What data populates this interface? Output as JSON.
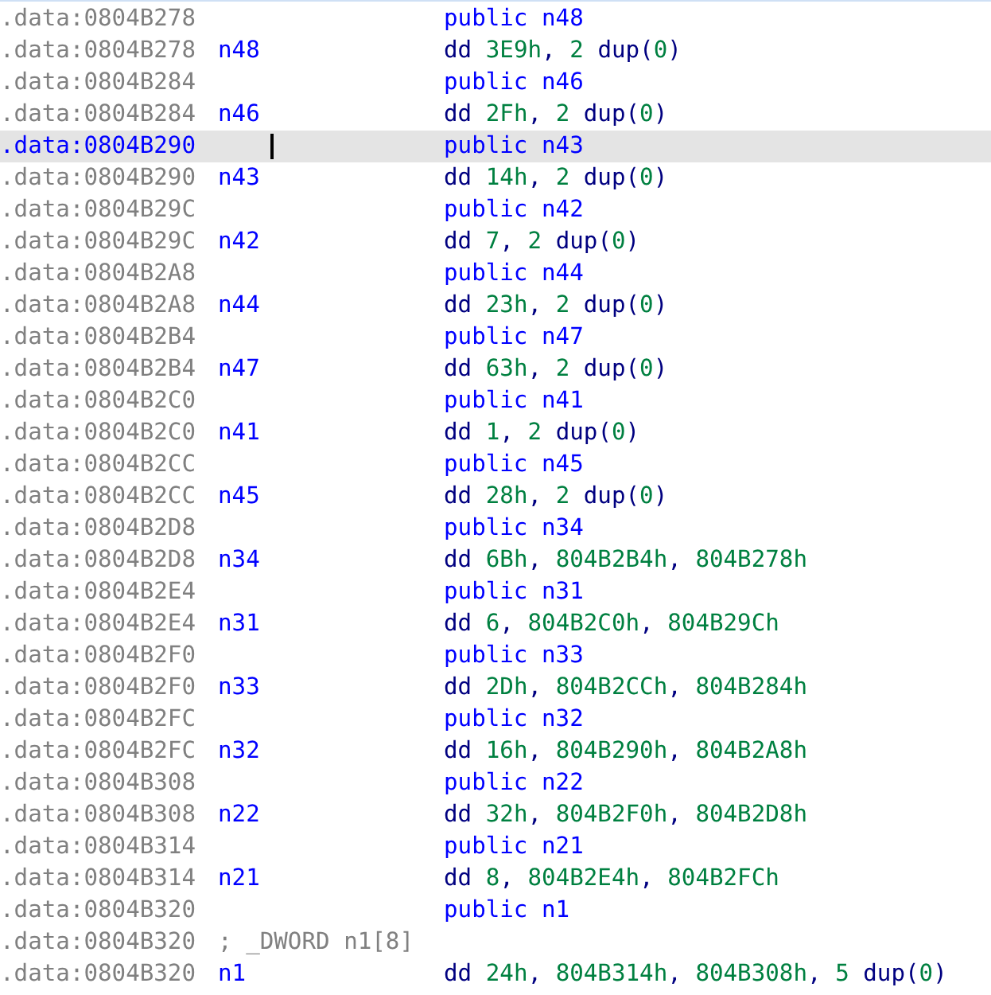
{
  "listing": [
    {
      "address": ".data:0804B278",
      "selected": false,
      "op": {
        "text": "public",
        "kind": "keyword"
      },
      "operands": [
        {
          "text": "n48",
          "kind": "name"
        }
      ]
    },
    {
      "address": ".data:0804B278",
      "label": "n48",
      "selected": false,
      "op": {
        "text": "dd",
        "kind": "directive"
      },
      "operands": [
        {
          "text": "3E9h",
          "kind": "number"
        },
        {
          "text": ", ",
          "kind": "punct"
        },
        {
          "text": "2",
          "kind": "number"
        },
        {
          "text": " dup(",
          "kind": "punct"
        },
        {
          "text": "0",
          "kind": "number"
        },
        {
          "text": ")",
          "kind": "punct"
        }
      ]
    },
    {
      "address": ".data:0804B284",
      "selected": false,
      "op": {
        "text": "public",
        "kind": "keyword"
      },
      "operands": [
        {
          "text": "n46",
          "kind": "name"
        }
      ]
    },
    {
      "address": ".data:0804B284",
      "label": "n46",
      "selected": false,
      "op": {
        "text": "dd",
        "kind": "directive"
      },
      "operands": [
        {
          "text": "2Fh",
          "kind": "number"
        },
        {
          "text": ", ",
          "kind": "punct"
        },
        {
          "text": "2",
          "kind": "number"
        },
        {
          "text": " dup(",
          "kind": "punct"
        },
        {
          "text": "0",
          "kind": "number"
        },
        {
          "text": ")",
          "kind": "punct"
        }
      ]
    },
    {
      "address": ".data:0804B290",
      "selected": true,
      "op": {
        "text": "public",
        "kind": "keyword"
      },
      "operands": [
        {
          "text": "n43",
          "kind": "name"
        }
      ]
    },
    {
      "address": ".data:0804B290",
      "label": "n43",
      "selected": false,
      "op": {
        "text": "dd",
        "kind": "directive"
      },
      "operands": [
        {
          "text": "14h",
          "kind": "number"
        },
        {
          "text": ", ",
          "kind": "punct"
        },
        {
          "text": "2",
          "kind": "number"
        },
        {
          "text": " dup(",
          "kind": "punct"
        },
        {
          "text": "0",
          "kind": "number"
        },
        {
          "text": ")",
          "kind": "punct"
        }
      ]
    },
    {
      "address": ".data:0804B29C",
      "selected": false,
      "op": {
        "text": "public",
        "kind": "keyword"
      },
      "operands": [
        {
          "text": "n42",
          "kind": "name"
        }
      ]
    },
    {
      "address": ".data:0804B29C",
      "label": "n42",
      "selected": false,
      "op": {
        "text": "dd",
        "kind": "directive"
      },
      "operands": [
        {
          "text": "7",
          "kind": "number"
        },
        {
          "text": ", ",
          "kind": "punct"
        },
        {
          "text": "2",
          "kind": "number"
        },
        {
          "text": " dup(",
          "kind": "punct"
        },
        {
          "text": "0",
          "kind": "number"
        },
        {
          "text": ")",
          "kind": "punct"
        }
      ]
    },
    {
      "address": ".data:0804B2A8",
      "selected": false,
      "op": {
        "text": "public",
        "kind": "keyword"
      },
      "operands": [
        {
          "text": "n44",
          "kind": "name"
        }
      ]
    },
    {
      "address": ".data:0804B2A8",
      "label": "n44",
      "selected": false,
      "op": {
        "text": "dd",
        "kind": "directive"
      },
      "operands": [
        {
          "text": "23h",
          "kind": "number"
        },
        {
          "text": ", ",
          "kind": "punct"
        },
        {
          "text": "2",
          "kind": "number"
        },
        {
          "text": " dup(",
          "kind": "punct"
        },
        {
          "text": "0",
          "kind": "number"
        },
        {
          "text": ")",
          "kind": "punct"
        }
      ]
    },
    {
      "address": ".data:0804B2B4",
      "selected": false,
      "op": {
        "text": "public",
        "kind": "keyword"
      },
      "operands": [
        {
          "text": "n47",
          "kind": "name"
        }
      ]
    },
    {
      "address": ".data:0804B2B4",
      "label": "n47",
      "selected": false,
      "op": {
        "text": "dd",
        "kind": "directive"
      },
      "operands": [
        {
          "text": "63h",
          "kind": "number"
        },
        {
          "text": ", ",
          "kind": "punct"
        },
        {
          "text": "2",
          "kind": "number"
        },
        {
          "text": " dup(",
          "kind": "punct"
        },
        {
          "text": "0",
          "kind": "number"
        },
        {
          "text": ")",
          "kind": "punct"
        }
      ]
    },
    {
      "address": ".data:0804B2C0",
      "selected": false,
      "op": {
        "text": "public",
        "kind": "keyword"
      },
      "operands": [
        {
          "text": "n41",
          "kind": "name"
        }
      ]
    },
    {
      "address": ".data:0804B2C0",
      "label": "n41",
      "selected": false,
      "op": {
        "text": "dd",
        "kind": "directive"
      },
      "operands": [
        {
          "text": "1",
          "kind": "number"
        },
        {
          "text": ", ",
          "kind": "punct"
        },
        {
          "text": "2",
          "kind": "number"
        },
        {
          "text": " dup(",
          "kind": "punct"
        },
        {
          "text": "0",
          "kind": "number"
        },
        {
          "text": ")",
          "kind": "punct"
        }
      ]
    },
    {
      "address": ".data:0804B2CC",
      "selected": false,
      "op": {
        "text": "public",
        "kind": "keyword"
      },
      "operands": [
        {
          "text": "n45",
          "kind": "name"
        }
      ]
    },
    {
      "address": ".data:0804B2CC",
      "label": "n45",
      "selected": false,
      "op": {
        "text": "dd",
        "kind": "directive"
      },
      "operands": [
        {
          "text": "28h",
          "kind": "number"
        },
        {
          "text": ", ",
          "kind": "punct"
        },
        {
          "text": "2",
          "kind": "number"
        },
        {
          "text": " dup(",
          "kind": "punct"
        },
        {
          "text": "0",
          "kind": "number"
        },
        {
          "text": ")",
          "kind": "punct"
        }
      ]
    },
    {
      "address": ".data:0804B2D8",
      "selected": false,
      "op": {
        "text": "public",
        "kind": "keyword"
      },
      "operands": [
        {
          "text": "n34",
          "kind": "name"
        }
      ]
    },
    {
      "address": ".data:0804B2D8",
      "label": "n34",
      "selected": false,
      "op": {
        "text": "dd",
        "kind": "directive"
      },
      "operands": [
        {
          "text": "6Bh",
          "kind": "number"
        },
        {
          "text": ", ",
          "kind": "punct"
        },
        {
          "text": "804B2B4h",
          "kind": "number"
        },
        {
          "text": ", ",
          "kind": "punct"
        },
        {
          "text": "804B278h",
          "kind": "number"
        }
      ]
    },
    {
      "address": ".data:0804B2E4",
      "selected": false,
      "op": {
        "text": "public",
        "kind": "keyword"
      },
      "operands": [
        {
          "text": "n31",
          "kind": "name"
        }
      ]
    },
    {
      "address": ".data:0804B2E4",
      "label": "n31",
      "selected": false,
      "op": {
        "text": "dd",
        "kind": "directive"
      },
      "operands": [
        {
          "text": "6",
          "kind": "number"
        },
        {
          "text": ", ",
          "kind": "punct"
        },
        {
          "text": "804B2C0h",
          "kind": "number"
        },
        {
          "text": ", ",
          "kind": "punct"
        },
        {
          "text": "804B29Ch",
          "kind": "number"
        }
      ]
    },
    {
      "address": ".data:0804B2F0",
      "selected": false,
      "op": {
        "text": "public",
        "kind": "keyword"
      },
      "operands": [
        {
          "text": "n33",
          "kind": "name"
        }
      ]
    },
    {
      "address": ".data:0804B2F0",
      "label": "n33",
      "selected": false,
      "op": {
        "text": "dd",
        "kind": "directive"
      },
      "operands": [
        {
          "text": "2Dh",
          "kind": "number"
        },
        {
          "text": ", ",
          "kind": "punct"
        },
        {
          "text": "804B2CCh",
          "kind": "number"
        },
        {
          "text": ", ",
          "kind": "punct"
        },
        {
          "text": "804B284h",
          "kind": "number"
        }
      ]
    },
    {
      "address": ".data:0804B2FC",
      "selected": false,
      "op": {
        "text": "public",
        "kind": "keyword"
      },
      "operands": [
        {
          "text": "n32",
          "kind": "name"
        }
      ]
    },
    {
      "address": ".data:0804B2FC",
      "label": "n32",
      "selected": false,
      "op": {
        "text": "dd",
        "kind": "directive"
      },
      "operands": [
        {
          "text": "16h",
          "kind": "number"
        },
        {
          "text": ", ",
          "kind": "punct"
        },
        {
          "text": "804B290h",
          "kind": "number"
        },
        {
          "text": ", ",
          "kind": "punct"
        },
        {
          "text": "804B2A8h",
          "kind": "number"
        }
      ]
    },
    {
      "address": ".data:0804B308",
      "selected": false,
      "op": {
        "text": "public",
        "kind": "keyword"
      },
      "operands": [
        {
          "text": "n22",
          "kind": "name"
        }
      ]
    },
    {
      "address": ".data:0804B308",
      "label": "n22",
      "selected": false,
      "op": {
        "text": "dd",
        "kind": "directive"
      },
      "operands": [
        {
          "text": "32h",
          "kind": "number"
        },
        {
          "text": ", ",
          "kind": "punct"
        },
        {
          "text": "804B2F0h",
          "kind": "number"
        },
        {
          "text": ", ",
          "kind": "punct"
        },
        {
          "text": "804B2D8h",
          "kind": "number"
        }
      ]
    },
    {
      "address": ".data:0804B314",
      "selected": false,
      "op": {
        "text": "public",
        "kind": "keyword"
      },
      "operands": [
        {
          "text": "n21",
          "kind": "name"
        }
      ]
    },
    {
      "address": ".data:0804B314",
      "label": "n21",
      "selected": false,
      "op": {
        "text": "dd",
        "kind": "directive"
      },
      "operands": [
        {
          "text": "8",
          "kind": "number"
        },
        {
          "text": ", ",
          "kind": "punct"
        },
        {
          "text": "804B2E4h",
          "kind": "number"
        },
        {
          "text": ", ",
          "kind": "punct"
        },
        {
          "text": "804B2FCh",
          "kind": "number"
        }
      ]
    },
    {
      "address": ".data:0804B320",
      "selected": false,
      "op": {
        "text": "public",
        "kind": "keyword"
      },
      "operands": [
        {
          "text": "n1",
          "kind": "name"
        }
      ]
    },
    {
      "address": ".data:0804B320",
      "selected": false,
      "comment": "; _DWORD n1[8]"
    },
    {
      "address": ".data:0804B320",
      "label": "n1",
      "selected": false,
      "op": {
        "text": "dd",
        "kind": "directive"
      },
      "operands": [
        {
          "text": "24h",
          "kind": "number"
        },
        {
          "text": ", ",
          "kind": "punct"
        },
        {
          "text": "804B314h",
          "kind": "number"
        },
        {
          "text": ", ",
          "kind": "punct"
        },
        {
          "text": "804B308h",
          "kind": "number"
        },
        {
          "text": ", ",
          "kind": "punct"
        },
        {
          "text": "5",
          "kind": "number"
        },
        {
          "text": " dup(",
          "kind": "punct"
        },
        {
          "text": "0",
          "kind": "number"
        },
        {
          "text": ")",
          "kind": "punct"
        }
      ]
    }
  ]
}
